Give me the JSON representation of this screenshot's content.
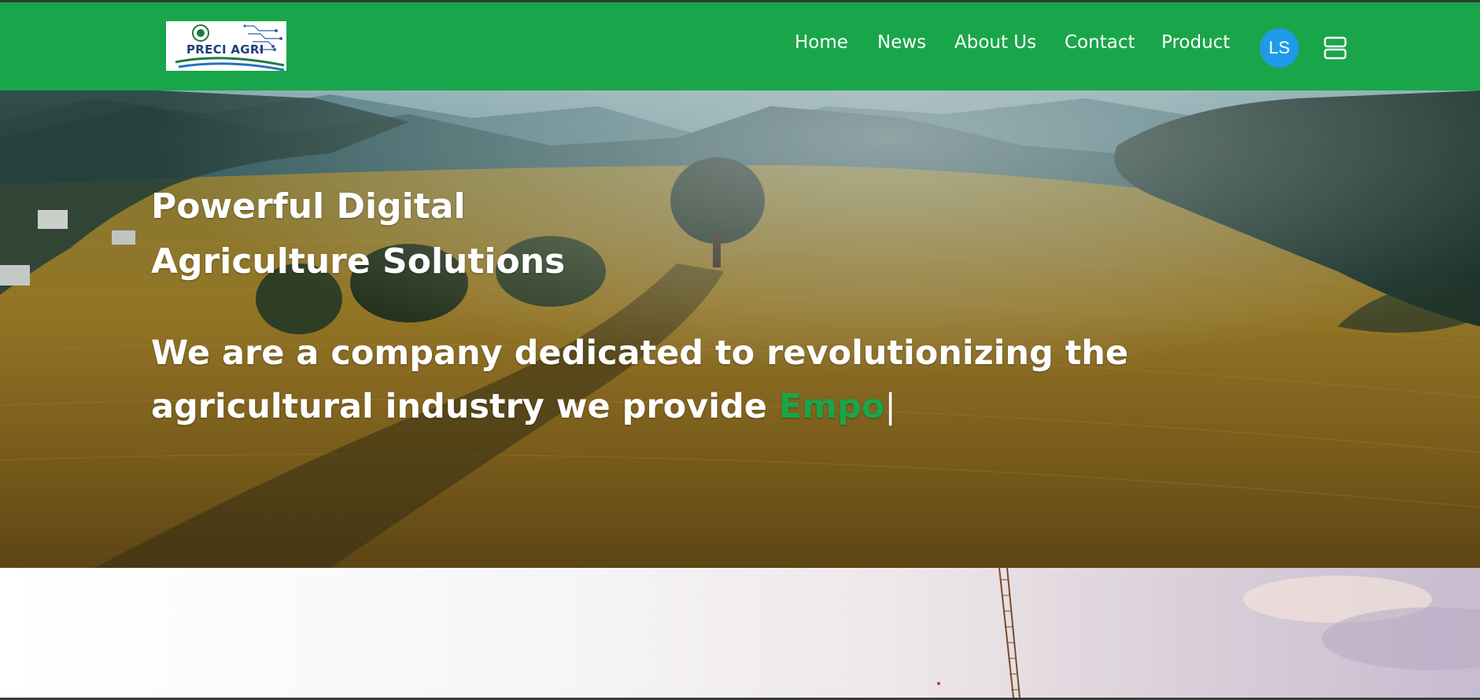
{
  "header": {
    "logo_text": "PRECI AGRI",
    "nav": {
      "home": "Home",
      "news": "News",
      "about": "About Us",
      "contact": "Contact",
      "product": "Product"
    },
    "avatar_initials": "LS",
    "menu_icon": "server-menu-icon"
  },
  "hero": {
    "title_line1": "Powerful Digital",
    "title_line2": "Agriculture Solutions",
    "subtitle_line1": "We are a company dedicated to revolutionizing the",
    "subtitle_line2": "agricultural industry we provide ",
    "typed_text": "Empo",
    "cursor": "|"
  },
  "colors": {
    "brand_green": "#19a64a",
    "avatar_blue": "#1e9be8",
    "logo_navy": "#1d3f7a"
  }
}
